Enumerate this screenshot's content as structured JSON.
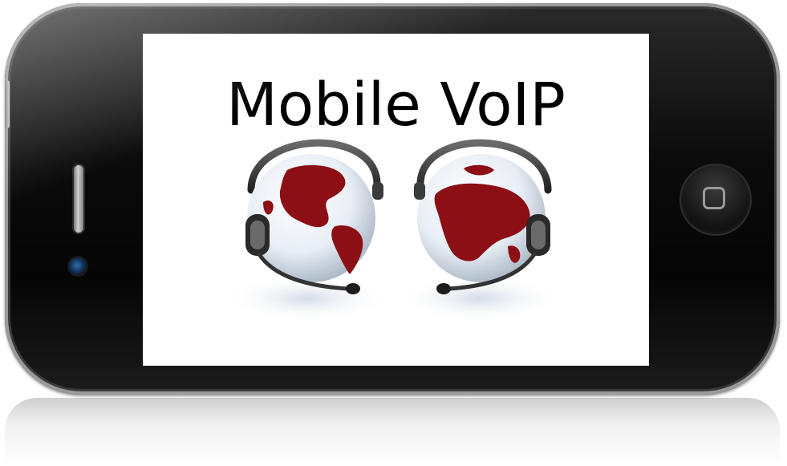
{
  "screen": {
    "title": "Mobile VoIP"
  },
  "icons": {
    "left_globe": "globe-with-headset",
    "right_globe": "globe-with-headset",
    "home": "home-button",
    "speaker": "earpiece-speaker",
    "camera": "front-camera"
  },
  "colors": {
    "globe_land": "#8b0f14",
    "globe_sea": "#e8eef5",
    "headset": "#3b3b3b",
    "phone_body": "#0b0b0b"
  }
}
